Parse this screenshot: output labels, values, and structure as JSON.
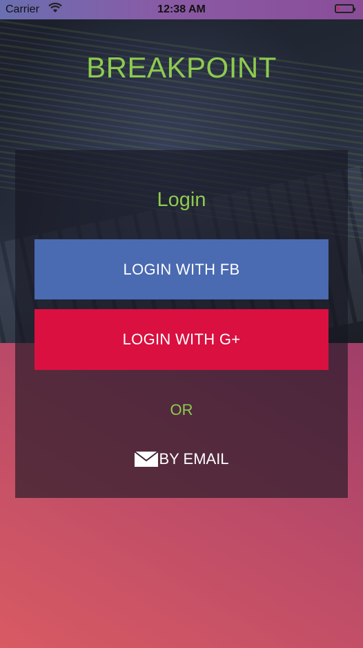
{
  "status_bar": {
    "carrier": "Carrier",
    "time": "12:38 AM",
    "wifi_icon": "wifi-icon",
    "battery_icon": "battery-icon",
    "battery_level": 0.15
  },
  "app": {
    "title": "BREAKPOINT"
  },
  "login": {
    "title": "Login",
    "fb_button_label": "LOGIN WITH FB",
    "google_button_label": "LOGIN WITH G+",
    "or_label": "OR",
    "email_label": "BY EMAIL",
    "email_icon": "mail-icon"
  },
  "colors": {
    "accent_green": "#8ecb4f",
    "facebook_blue": "#4a6ab2",
    "google_red": "#da1040"
  }
}
